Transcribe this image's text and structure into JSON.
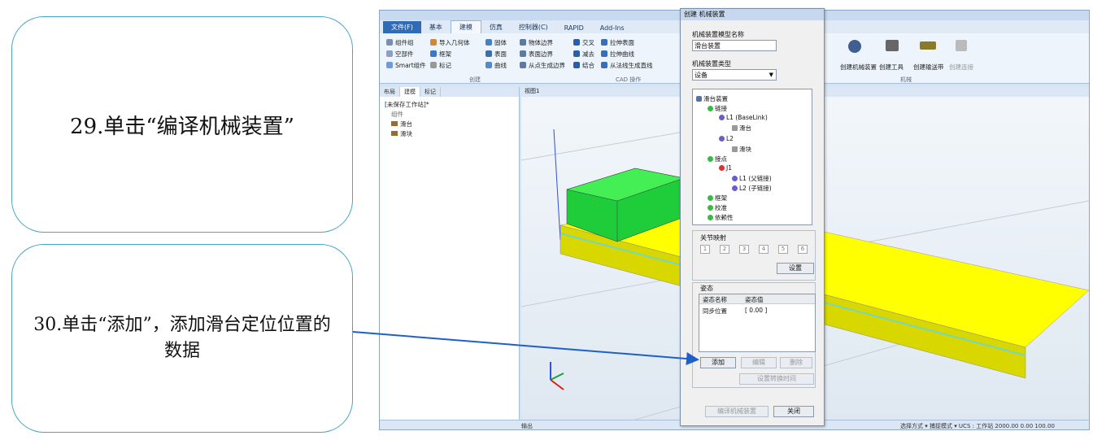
{
  "instructions": {
    "step29": "29.单击“编译机械装置”",
    "step30": "30.单击“添加”，添加滑台定位位置的数据"
  },
  "app": {
    "menu_tabs": [
      "文件(F)",
      "基本",
      "建模",
      "仿真",
      "控制器(C)",
      "RAPID",
      "Add-Ins"
    ],
    "ribbon": {
      "items": [
        "组件组",
        "空部件",
        "Smart组件",
        "导入几何体",
        "框架",
        "标记",
        "固体",
        "表面",
        "曲线",
        "物体边界",
        "表面边界",
        "从点生成边界",
        "交叉",
        "减去",
        "结合",
        "拉伸表面",
        "拉伸曲线",
        "从法线生成直线",
        "创建机械装置",
        "创建工具",
        "创建输送带",
        "创建连接"
      ],
      "groups": [
        "创建",
        "CAD 操作",
        "机械"
      ]
    },
    "tree_tabs": [
      "布局",
      "建模",
      "标记"
    ],
    "tree": [
      "[未保存工作站]*",
      "组件",
      "滑台",
      "滑块"
    ],
    "view_tab": "视图1",
    "output_label": "输出",
    "status_text": "选择方式 ▾  捕捉模式 ▾   UCS : 工作站   2000.00  0.00  100.00"
  },
  "dialog": {
    "title": "创建 机械装置",
    "model_name_label": "机械装置模型名称",
    "model_name_value": "滑台装置",
    "type_label": "机械装置类型",
    "type_value": "设备",
    "tree": {
      "root": "滑台装置",
      "links": "链接",
      "l1": "L1 (BaseLink)",
      "slide_table": "滑台",
      "l2": "L2",
      "slider": "滑块",
      "joints": "接点",
      "j1": "J1",
      "l1_parent": "L1 (父链接)",
      "l2_child": "L2 (子链接)",
      "frame": "框架",
      "calibration": "校准",
      "dependency": "依赖性"
    },
    "joint_mapping_label": "关节映射",
    "joint_numbers": [
      "1",
      "2",
      "3",
      "4",
      "5",
      "6"
    ],
    "settings_button": "设置",
    "posture_label": "姿态",
    "posture_col_name": "姿态名称",
    "posture_col_value": "姿态值",
    "posture_row_name": "同步位置",
    "posture_row_value": "[ 0.00 ]",
    "add_button": "添加",
    "edit_button": "编辑",
    "delete_button": "删除",
    "set_transition_button": "设置转换时间",
    "compile_button": "编译机械装置",
    "close_button": "关闭"
  },
  "colors": {
    "bubble_border": "#4aa6c6",
    "arrow": "#1f5fc8",
    "box_green": "#22dd44",
    "base_yellow": "#ffff00"
  }
}
